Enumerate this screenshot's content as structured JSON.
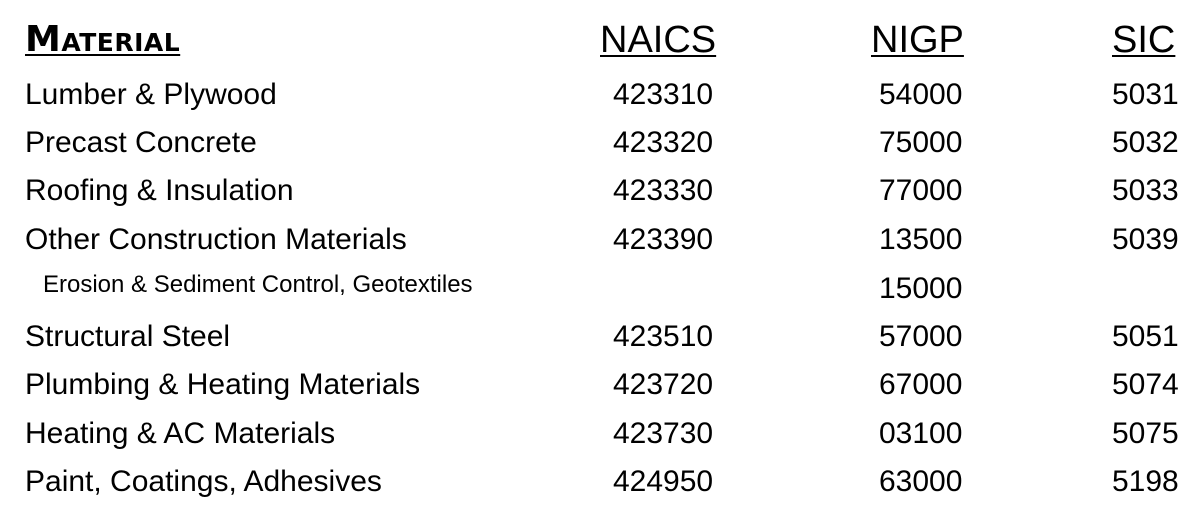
{
  "table": {
    "headers": {
      "material": "Material",
      "naics": "NAICS",
      "nigp": "NIGP",
      "sic": "SIC"
    },
    "rows": [
      {
        "material": "Lumber & Plywood",
        "naics": "423310",
        "nigp": "54000",
        "sic": "5031",
        "indent": false
      },
      {
        "material": "Precast Concrete",
        "naics": "423320",
        "nigp": "75000",
        "sic": "5032",
        "indent": false
      },
      {
        "material": "Roofing & Insulation",
        "naics": "423330",
        "nigp": "77000",
        "sic": "5033",
        "indent": false
      },
      {
        "material": "Other Construction Materials",
        "naics": "423390",
        "nigp": "13500",
        "sic": "5039",
        "indent": false
      },
      {
        "material": "Erosion & Sediment Control, Geotextiles",
        "naics": "",
        "nigp": "15000",
        "sic": "",
        "indent": true
      },
      {
        "material": "Structural Steel",
        "naics": "423510",
        "nigp": "57000",
        "sic": "5051",
        "indent": false
      },
      {
        "material": "Plumbing & Heating Materials",
        "naics": "423720",
        "nigp": "67000",
        "sic": "5074",
        "indent": false
      },
      {
        "material": "Heating & AC Materials",
        "naics": "423730",
        "nigp": "03100",
        "sic": "5075",
        "indent": false
      },
      {
        "material": "Paint, Coatings, Adhesives",
        "naics": "424950",
        "nigp": "63000",
        "sic": "5198",
        "indent": false
      }
    ]
  }
}
